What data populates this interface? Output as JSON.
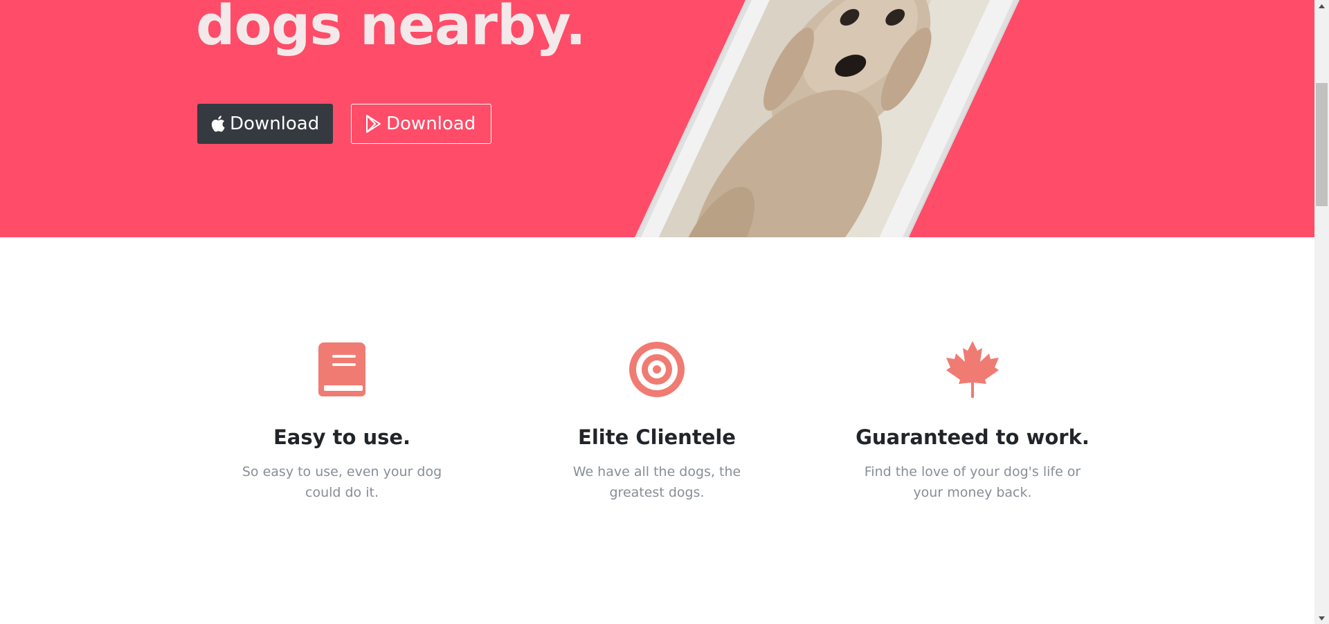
{
  "hero": {
    "title": "dogs nearby.",
    "background_color": "#ff4c68",
    "buttons": [
      {
        "label": "Download",
        "icon": "apple-icon",
        "style": "dark"
      },
      {
        "label": "Download",
        "icon": "google-play-icon",
        "style": "outline"
      }
    ],
    "phone_image": "dog-photo"
  },
  "features": {
    "accent_color": "#f07b72",
    "items": [
      {
        "icon": "book-icon",
        "title": "Easy to use.",
        "description": "So easy to use, even your dog could do it."
      },
      {
        "icon": "target-icon",
        "title": "Elite Clientele",
        "description": "We have all the dogs, the greatest dogs."
      },
      {
        "icon": "maple-leaf-icon",
        "title": "Guaranteed to work.",
        "description": "Find the love of your dog's life or your money back."
      }
    ]
  }
}
